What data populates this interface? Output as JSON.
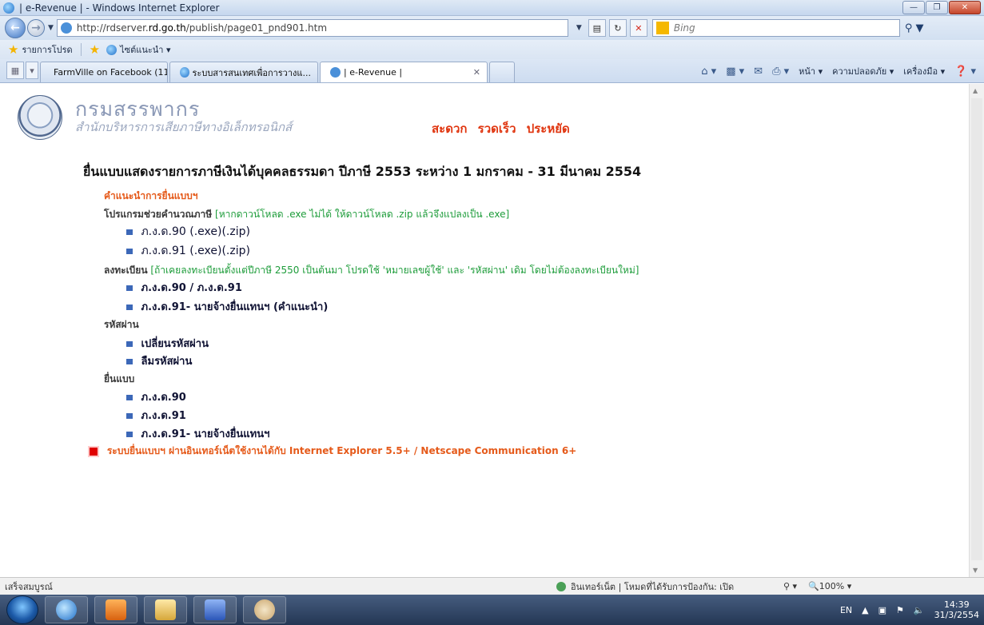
{
  "window": {
    "title": "| e-Revenue | - Windows Internet Explorer"
  },
  "address_bar": {
    "url_prefix": "http://rdserver.",
    "url_domain": "rd.go.th",
    "url_suffix": "/publish/page01_pnd901.htm",
    "search_placeholder": "Bing"
  },
  "favorites_bar": {
    "favorites_label": "รายการโปรด",
    "suggested_sites_label": "ไซต์แนะนำ ▾"
  },
  "tabs": [
    {
      "label": "FarmVille on Facebook (11)"
    },
    {
      "label": "ระบบสารสนเทศเพื่อการวางแ..."
    },
    {
      "label": "| e-Revenue |"
    }
  ],
  "command_bar": {
    "page": "หน้า ▾",
    "safety": "ความปลอดภัย ▾",
    "tools": "เครื่องมือ ▾"
  },
  "header": {
    "org_name": "กรมสรรพากร",
    "org_sub": "สำนักบริหารการเสียภาษีทางอิเล็กทรอนิกส์",
    "slogan": "สะดวก รวดเร็ว ประหยัด"
  },
  "page_title": "ยื่นแบบแสดงรายการภาษีเงินได้บุคคลธรรมดา ปีภาษี 2553 ระหว่าง 1 มกราคม - 31 มีนาคม 2554",
  "content": {
    "instructions_link": "คำแนะนำการยื่นแบบฯ",
    "calc_program_label": "โปรแกรมช่วยคำนวณภาษี",
    "calc_program_note": "[หากดาวน์โหลด .exe ไม่ได้ ให้ดาวน์โหลด .zip แล้วจึงแปลงเป็น .exe]",
    "calc_items": [
      {
        "name": "ภ.ง.ด.90",
        "exe": "(.exe)",
        "zip": "(.zip)"
      },
      {
        "name": "ภ.ง.ด.91",
        "exe": "(.exe)",
        "zip": "(.zip)"
      }
    ],
    "register_label": "ลงทะเบียน",
    "register_note": "[ถ้าเคยลงทะเบียนตั้งแต่ปีภาษี 2550 เป็นต้นมา โปรดใช้ 'หมายเลขผู้ใช้' และ 'รหัสผ่าน' เดิม โดยไม่ต้องลงทะเบียนใหม่]",
    "register_items": [
      "ภ.ง.ด.90 / ภ.ง.ด.91",
      "ภ.ง.ด.91- นายจ้างยื่นแทนฯ (คำแนะนำ)"
    ],
    "password_label": "รหัสผ่าน",
    "password_items": [
      "เปลี่ยนรหัสผ่าน",
      "ลืมรหัสผ่าน"
    ],
    "filing_label": "ยื่นแบบ",
    "filing_items": [
      "ภ.ง.ด.90",
      "ภ.ง.ด.91",
      "ภ.ง.ด.91- นายจ้างยื่นแทนฯ"
    ],
    "browser_note": "ระบบยื่นแบบฯ ผ่านอินเทอร์เน็ตใช้งานได้กับ Internet Explorer 5.5+ / Netscape Communication 6+"
  },
  "status_bar": {
    "status": "เสร็จสมบูรณ์",
    "zone": "อินเทอร์เน็ต | โหมดที่ได้รับการป้องกัน: เปิด",
    "zoom": "100%"
  },
  "taskbar": {
    "lang": "EN",
    "time": "14:39",
    "date": "31/3/2554"
  },
  "colors": {
    "accent_orange": "#e55a1a",
    "note_green": "#1d9c3a",
    "slogan_red": "#e0350f",
    "bullet_blue": "#3c68b8"
  }
}
